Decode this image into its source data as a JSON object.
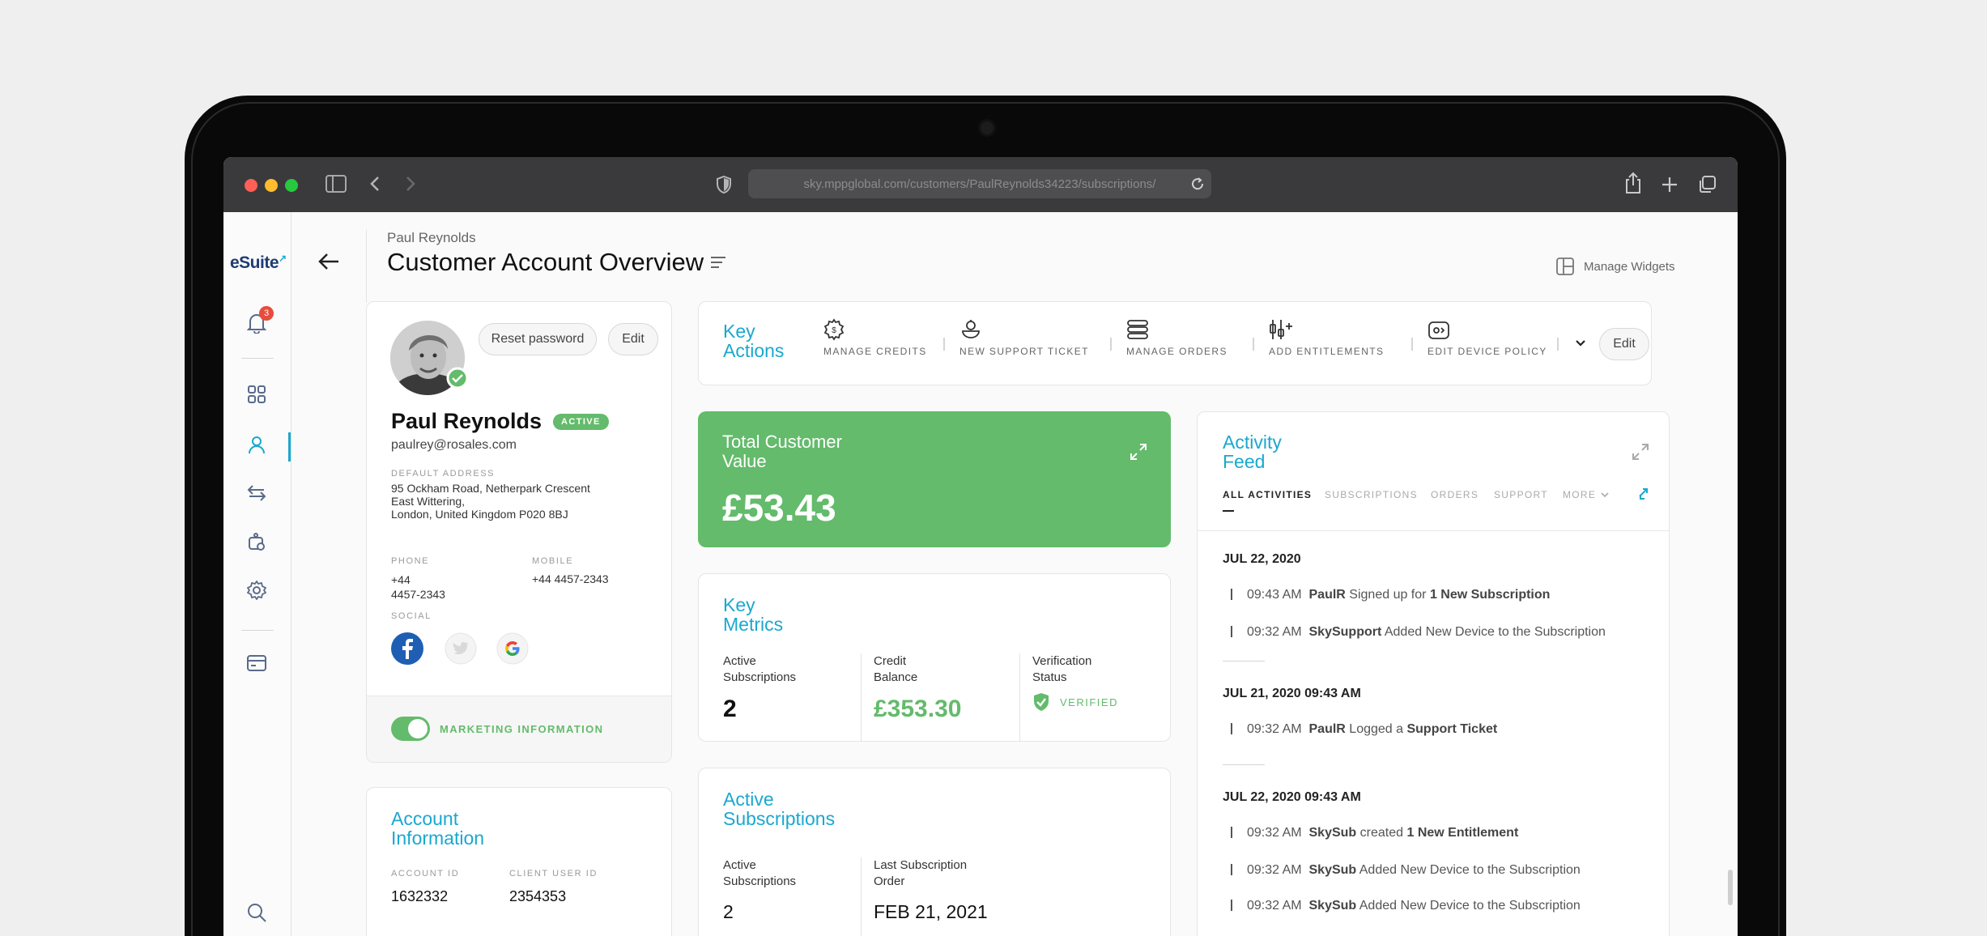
{
  "browser": {
    "url": "sky.mppglobal.com/customers/PaulReynolds34223/subscriptions/"
  },
  "app": {
    "logo": "eSuite",
    "notification_count": "3"
  },
  "header": {
    "breadcrumb": "Paul Reynolds",
    "title": "Customer Account Overview",
    "manage_widgets": "Manage Widgets"
  },
  "profile": {
    "reset_password": "Reset password",
    "edit": "Edit",
    "name": "Paul Reynolds",
    "status": "ACTIVE",
    "email": "paulrey@rosales.com",
    "address_label": "DEFAULT ADDRESS",
    "address_lines": [
      "95 Ockham Road, Netherpark Crescent",
      "East Wittering,",
      "London, United Kingdom  P020 8BJ"
    ],
    "phone_label": "PHONE",
    "phone_lines": [
      "+44",
      "4457-2343"
    ],
    "mobile_label": "MOBILE",
    "mobile": "+44 4457-2343",
    "social_label": "SOCIAL",
    "marketing_label": "MARKETING INFORMATION"
  },
  "account_info": {
    "title_lines": [
      "Account",
      "Information"
    ],
    "account_id_label": "ACCOUNT ID",
    "account_id": "1632332",
    "client_user_id_label": "CLIENT USER ID",
    "client_user_id": "2354353"
  },
  "key_actions": {
    "title_lines": [
      "Key",
      "Actions"
    ],
    "items": [
      {
        "label": "MANAGE CREDITS",
        "icon": "gear-credits-icon"
      },
      {
        "label": "NEW SUPPORT TICKET",
        "icon": "support-ticket-icon"
      },
      {
        "label": "MANAGE ORDERS",
        "icon": "orders-icon"
      },
      {
        "label": "ADD ENTITLEMENTS",
        "icon": "entitlements-icon"
      },
      {
        "label": "EDIT DEVICE POLICY",
        "icon": "device-policy-icon"
      }
    ],
    "edit": "Edit"
  },
  "total_value": {
    "title_lines": [
      "Total Customer",
      "Value"
    ],
    "amount": "£53.43"
  },
  "key_metrics": {
    "title_lines": [
      "Key",
      "Metrics"
    ],
    "active_subs_label": [
      "Active",
      "Subscriptions"
    ],
    "active_subs": "2",
    "credit_label": [
      "Credit",
      "Balance"
    ],
    "credit": "£353.30",
    "verification_label": [
      "Verification",
      "Status"
    ],
    "verification": "VERIFIED"
  },
  "active_subscriptions": {
    "title_lines": [
      "Active",
      "Subscriptions"
    ],
    "count_label": [
      "Active",
      "Subscriptions"
    ],
    "count": "2",
    "last_order_label": [
      "Last Subscription",
      "Order"
    ],
    "last_order": "FEB 21, 2021"
  },
  "activity_feed": {
    "title_lines": [
      "Activity",
      "Feed"
    ],
    "tabs": [
      "ALL ACTIVITIES",
      "SUBSCRIPTIONS",
      "ORDERS",
      "SUPPORT",
      "MORE"
    ],
    "groups": [
      {
        "date": "JUL 22, 2020",
        "items": [
          {
            "time": "09:43 AM",
            "actor": "PaulR",
            "pre": "Signed up for",
            "strong": "1 New Subscription",
            "post": ""
          },
          {
            "time": "09:32 AM",
            "actor": "SkySupport",
            "pre": "Added New Device to the Subscription",
            "strong": "",
            "post": ""
          }
        ]
      },
      {
        "date": "JUL 21, 2020  09:43 AM",
        "items": [
          {
            "time": "09:32 AM",
            "actor": "PaulR",
            "pre": "Logged a",
            "strong": "Support Ticket",
            "post": ""
          }
        ]
      },
      {
        "date": "JUL 22, 2020  09:43 AM",
        "items": [
          {
            "time": "09:32 AM",
            "actor": "SkySub",
            "pre": "created",
            "strong": "1 New Entitlement",
            "post": ""
          },
          {
            "time": "09:32 AM",
            "actor": "SkySub",
            "pre": "Added New Device to the Subscription",
            "strong": "",
            "post": ""
          },
          {
            "time": "09:32 AM",
            "actor": "SkySub",
            "pre": "Added New Device to the Subscription",
            "strong": "",
            "post": ""
          }
        ]
      }
    ]
  },
  "colors": {
    "accent": "#1aa8cf",
    "green": "#63bb6b",
    "alert": "#e74c3c"
  }
}
